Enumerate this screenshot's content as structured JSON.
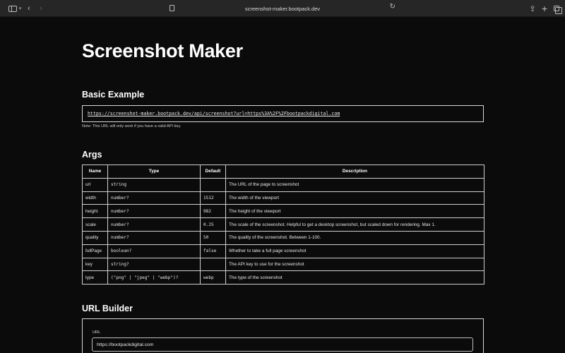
{
  "browser": {
    "url": "screenshot-maker.bootpack.dev",
    "icons": {
      "sidebar": "sidebar-icon",
      "back": "chevron-left-icon",
      "forward": "chevron-right-icon",
      "lock": "lock-icon",
      "reload": "reload-icon",
      "share": "share-icon",
      "new_tab": "plus-icon",
      "tabs": "tabs-overview-icon"
    }
  },
  "page": {
    "title": "Screenshot Maker",
    "basic_example": {
      "heading": "Basic Example",
      "url": "https://screenshot-maker.bootpack.dev/api/screenshot?url=https%3A%2F%2Fbootpackdigital.com",
      "note": "Note: This URL will only work if you have a valid API key."
    },
    "args": {
      "heading": "Args",
      "columns": [
        "Name",
        "Type",
        "Default",
        "Description"
      ],
      "rows": [
        {
          "name": "url",
          "type": "string",
          "default": "",
          "description": "The URL of the page to screenshot"
        },
        {
          "name": "width",
          "type": "number?",
          "default": "1512",
          "description": "The width of the viewport"
        },
        {
          "name": "height",
          "type": "number?",
          "default": "982",
          "description": "The height of the viewport"
        },
        {
          "name": "scale",
          "type": "number?",
          "default": "0.25",
          "description": "The scale of the screenshot. Helpful to get a desktop screenshot, but scaled down for rendering. Max 1."
        },
        {
          "name": "quality",
          "type": "number?",
          "default": "50",
          "description": "The quality of the screenshot. Between 1-100."
        },
        {
          "name": "fullPage",
          "type": "boolean?",
          "default": "false",
          "description": "Whether to take a full page screenshot"
        },
        {
          "name": "key",
          "type": "string?",
          "default": "",
          "description": "The API key to use for the screenshot"
        },
        {
          "name": "type",
          "type": "(\"png\" | \"jpeg\" | \"webp\")?",
          "default": "webp",
          "description": "The type of the screenshot"
        }
      ]
    },
    "url_builder": {
      "heading": "URL Builder",
      "url_label": "URL",
      "url_value": "https://bootpackdigital.com"
    }
  }
}
